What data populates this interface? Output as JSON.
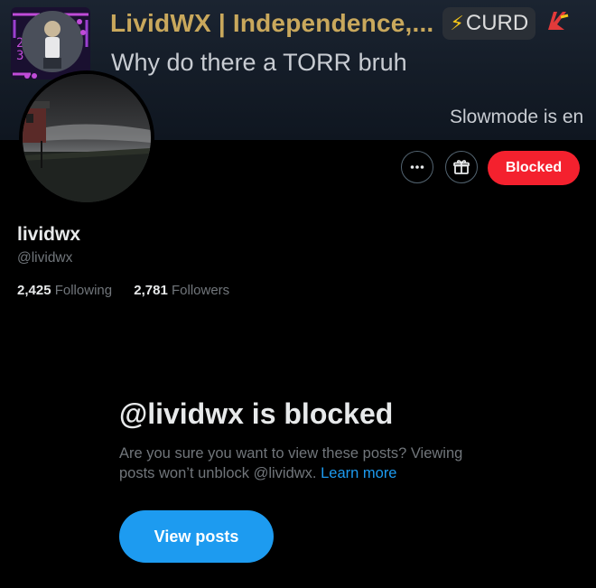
{
  "banner": {
    "title": "LividWX | Independence,...",
    "badge_label": "CURD",
    "subtitle": "Why do there a TORR bruh",
    "slowmode_text": "Slowmode is en"
  },
  "profile": {
    "display_name": "lividwx",
    "handle": "@lividwx",
    "following_count": "2,425",
    "following_label": "Following",
    "followers_count": "2,781",
    "followers_label": "Followers"
  },
  "actions": {
    "more_icon": "more-horizontal-icon",
    "subscribe_icon": "gift-icon",
    "blocked_label": "Blocked"
  },
  "blocked_notice": {
    "heading": "@lividwx is blocked",
    "description": "Are you sure you want to view these posts? Viewing posts won’t unblock @lividwx.",
    "learn_more": "Learn more",
    "button_label": "View posts"
  },
  "colors": {
    "background": "#000000",
    "accent": "#1d9bf0",
    "blocked_red": "#f4212e",
    "secondary_text": "#71767b",
    "banner_title": "#c9a85c"
  }
}
